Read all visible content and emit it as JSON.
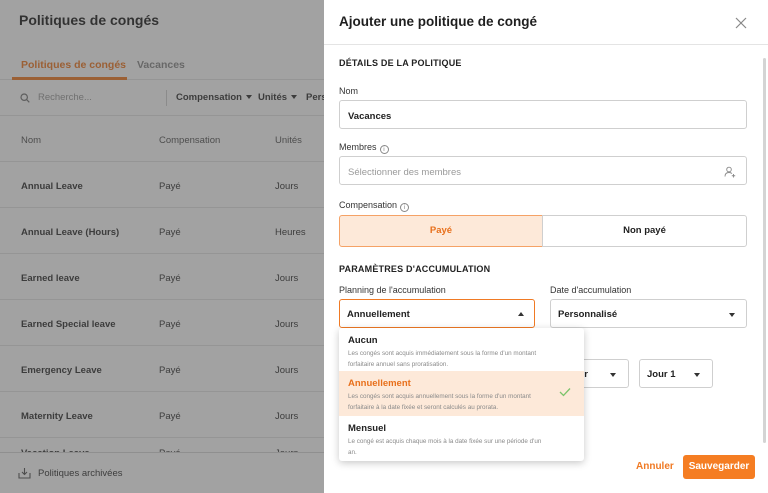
{
  "page": {
    "title": "Politiques de congés",
    "tabs": [
      {
        "label": "Politiques de congés",
        "active": true
      },
      {
        "label": "Vacances",
        "active": false
      }
    ],
    "search_placeholder": "Recherche...",
    "filters": [
      "Compensation",
      "Unités",
      "Pers"
    ],
    "columns": [
      "Nom",
      "Compensation",
      "Unités"
    ],
    "rows": [
      {
        "name": "Annual Leave",
        "compensation": "Payé",
        "unit": "Jours"
      },
      {
        "name": "Annual Leave (Hours)",
        "compensation": "Payé",
        "unit": "Heures"
      },
      {
        "name": "Earned leave",
        "compensation": "Payé",
        "unit": "Jours"
      },
      {
        "name": "Earned Special leave",
        "compensation": "Payé",
        "unit": "Jours"
      },
      {
        "name": "Emergency Leave",
        "compensation": "Payé",
        "unit": "Jours"
      },
      {
        "name": "Maternity Leave",
        "compensation": "Payé",
        "unit": "Jours"
      },
      {
        "name": "Vacation Leave",
        "compensation": "Payé",
        "unit": "Jours"
      }
    ],
    "archived_label": "Politiques archivées"
  },
  "drawer": {
    "title": "Ajouter une politique de congé",
    "section_details": "DÉTAILS DE LA POLITIQUE",
    "name_label": "Nom",
    "name_value": "Vacances",
    "members_label": "Membres",
    "members_placeholder": "Sélectionner des membres",
    "compensation_label": "Compensation",
    "compensation_options": [
      "Payé",
      "Non payé"
    ],
    "section_accrual": "PARAMÈTRES D'ACCUMULATION",
    "schedule_label": "Planning de l'accumulation",
    "schedule_value": "Annuellement",
    "accrual_date_label": "Date d'accumulation",
    "accrual_date_value": "Personnalisé",
    "month_value_partial": "er",
    "day_value": "Jour 1",
    "dropdown_options": [
      {
        "title": "Aucun",
        "desc": "Les congés sont acquis immédiatement sous la forme d'un montant forfaitaire annuel sans proratisation.",
        "selected": false
      },
      {
        "title": "Annuellement",
        "desc": "Les congés sont acquis annuellement sous la forme d'un montant forfaitaire à la date fixée et seront calculés au prorata.",
        "selected": true
      },
      {
        "title": "Mensuel",
        "desc": "Le congé est acquis chaque mois à la date fixée sur une période d'un an.",
        "selected": false
      }
    ],
    "cancel_label": "Annuler",
    "save_label": "Sauvegarder"
  },
  "colors": {
    "accent": "#f57d22",
    "accent_light": "#fde9d9",
    "overlay": "#464646"
  }
}
